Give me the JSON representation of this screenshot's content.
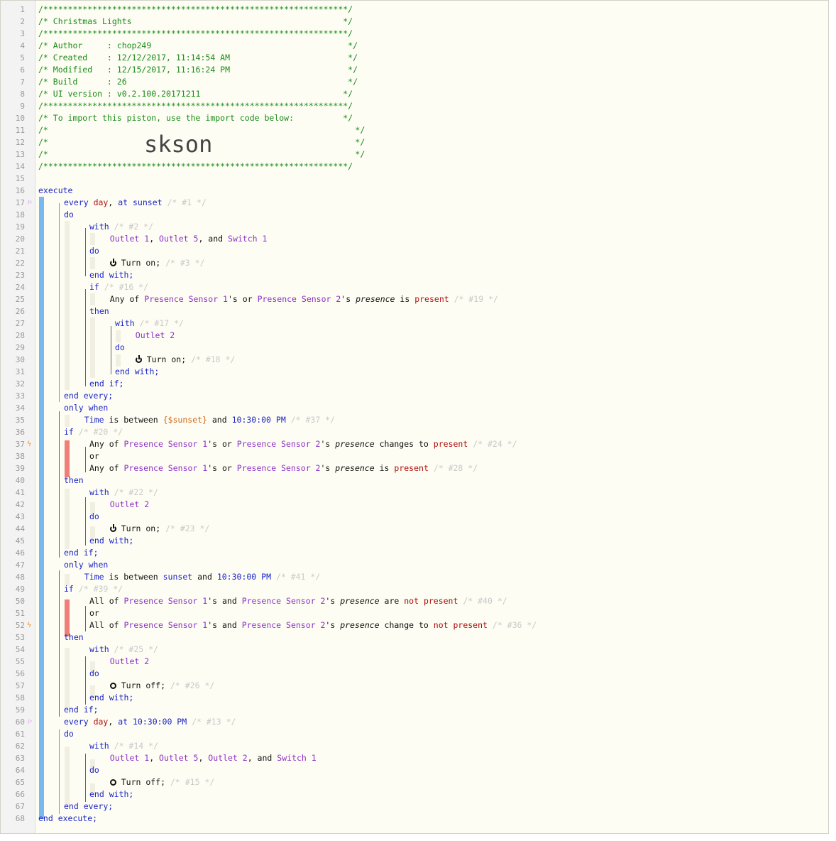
{
  "header": {
    "border": "/**************************************************************/",
    "title_line": "/* Christmas Lights                                           */",
    "author_line": "/* Author     : chop249                                        */",
    "created_line": "/* Created    : 12/12/2017, 11:14:54 AM                        */",
    "modified_line": "/* Modified   : 12/15/2017, 11:16:24 PM                        */",
    "build_line": "/* Build      : 26                                             */",
    "ui_line": "/* UI version : v0.2.100.20171211                             */",
    "import_line": "/* To import this piston, use the import code below:          */",
    "blank_line_left": "/*",
    "blank_line_right": "*/",
    "import_code": "skson"
  },
  "code": {
    "execute": "execute",
    "end_execute": "end execute;",
    "every": "every",
    "day": "day",
    "at": "at",
    "sunset": "sunset",
    "do": "do",
    "with": "with",
    "end_with": "end with;",
    "if": "if",
    "then": "then",
    "end_if": "end if;",
    "end_every": "end every;",
    "only_when": "only when",
    "or": "or",
    "and": "and",
    "any_of": "Any of",
    "all_of": "All of",
    "is": "is",
    "are": "are",
    "is_between": "is between",
    "changes_to": "changes to",
    "change_to": "change to",
    "present": "present",
    "not_present": "not present",
    "presence": "presence",
    "turn_on": "Turn on;",
    "turn_off": "Turn off;",
    "time": "Time",
    "var_sunset": "{$sunset}",
    "time_1030": "10:30:00 PM",
    "possessive": "'s",
    "comma": ",",
    "and_word": "and"
  },
  "devices": {
    "outlet1": "Outlet 1",
    "outlet2": "Outlet 2",
    "outlet5": "Outlet 5",
    "switch1": "Switch 1",
    "presence1": "Presence Sensor 1",
    "presence2": "Presence Sensor 2"
  },
  "ids": {
    "s1": "/* #1 */",
    "s2": "/* #2 */",
    "s3": "/* #3 */",
    "s16": "/* #16 */",
    "s19": "/* #19 */",
    "s17": "/* #17 */",
    "s18": "/* #18 */",
    "s37": "/* #37 */",
    "s20": "/* #20 */",
    "s24": "/* #24 */",
    "s28": "/* #28 */",
    "s22": "/* #22 */",
    "s23": "/* #23 */",
    "s41": "/* #41 */",
    "s39": "/* #39 */",
    "s40": "/* #40 */",
    "s36": "/* #36 */",
    "s25": "/* #25 */",
    "s26": "/* #26 */",
    "s13": "/* #13 */",
    "s14": "/* #14 */",
    "s15": "/* #15 */"
  },
  "gutter": {
    "line_numbers": [
      "1",
      "2",
      "3",
      "4",
      "5",
      "6",
      "7",
      "8",
      "9",
      "10",
      "11",
      "12",
      "13",
      "14",
      "15",
      "16",
      "17",
      "18",
      "19",
      "20",
      "21",
      "22",
      "23",
      "24",
      "25",
      "26",
      "27",
      "28",
      "29",
      "30",
      "31",
      "32",
      "33",
      "34",
      "35",
      "36",
      "37",
      "38",
      "39",
      "40",
      "41",
      "42",
      "43",
      "44",
      "45",
      "46",
      "47",
      "48",
      "49",
      "50",
      "51",
      "52",
      "53",
      "54",
      "55",
      "56",
      "57",
      "58",
      "59",
      "60",
      "61",
      "62",
      "63",
      "64",
      "65",
      "66",
      "67",
      "68"
    ],
    "trigger_glyph": "⚐",
    "bolt_glyph": "ϟ"
  }
}
